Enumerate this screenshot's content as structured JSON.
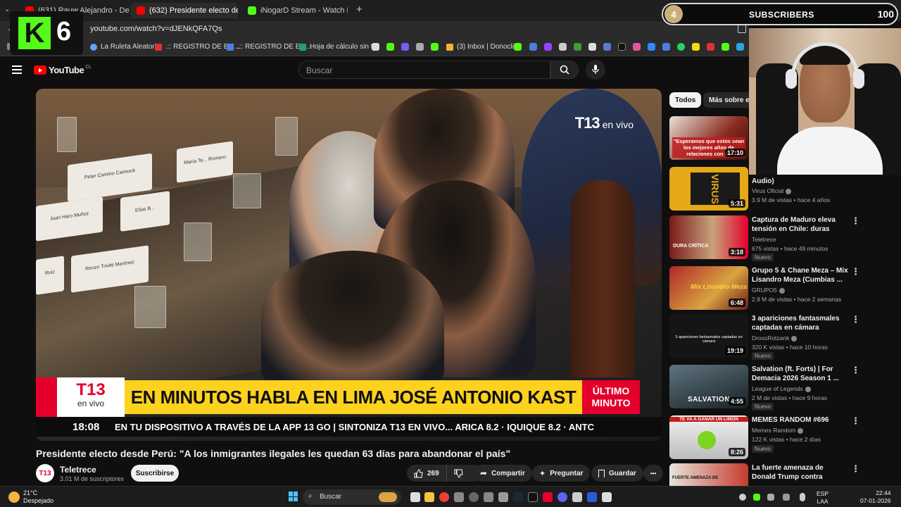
{
  "browser": {
    "tabs": [
      {
        "label": "(631) Rauw Alejandro - Detectiv",
        "active": false,
        "color": "#ff0000"
      },
      {
        "label": "(632) Presidente electo des",
        "active": true,
        "color": "#ff0000"
      },
      {
        "label": "iNogarD Stream - Watch Live o",
        "active": false,
        "color": "#53fc18"
      }
    ],
    "new_tab": "+",
    "url": "youtube.com/watch?v=dJENkQFA7Qs",
    "bookmarks": [
      {
        "label": "La Ruleta Aleatoria"
      },
      {
        "label": ".:: REGISTRO DE EM..."
      },
      {
        "label": ".:: REGISTRO DE EM..."
      },
      {
        "label": "Hoja de cálculo sin t..."
      },
      {
        "label": "(3) Inbox | Donoclip"
      }
    ]
  },
  "youtube": {
    "logo": "YouTube",
    "country": "CL",
    "search_placeholder": "Buscar",
    "video": {
      "overlay_brand": "T13",
      "overlay_live": "en vivo",
      "nameplates": [
        "Peter Camino Cannock",
        "Juan Haro Muñoz",
        "Ruiz",
        "Renzo Trivitti Martínez",
        "Elías B...",
        "María Te... Romero"
      ],
      "lower_third_brand": "T13",
      "lower_third_live": "en vivo",
      "headline": "EN MINUTOS HABLA EN LIMA JOSÉ ANTONIO KAST",
      "breaking_line1": "ÚLTIMO",
      "breaking_line2": "MINUTO",
      "ticker_time": "18:08",
      "ticker_text": "EN TU DISPOSITIVO A TRAVÉS DE LA APP 13 GO   |   SINTONIZA T13 EN VIVO... ARICA 8.2  ·  IQUIQUE 8.2  ·  ANTC"
    },
    "title": "Presidente electo desde Perú: \"A los inmigrantes ilegales les quedan 63 días para abandonar el país\"",
    "channel": {
      "avatar": "T13",
      "name": "Teletrece",
      "subscribers": "3.01 M de suscriptores",
      "subscribe_label": "Suscribirse"
    },
    "actions": {
      "likes": "269",
      "share": "Compartir",
      "ask": "Preguntar",
      "save": "Guardar",
      "more": "•••"
    },
    "chips": [
      "Todos",
      "Más sobre es"
    ],
    "recommendations": [
      {
        "title": "\"Esperamos que estos sean los mejores años de relaciones con Pe...",
        "thumb_text": "\"Esperamos que estos sean los mejores años de relaciones con Pe",
        "channel": "",
        "meta": "",
        "duration": "17:10",
        "badge": "",
        "thumb_color": "#8a2b1f"
      },
      {
        "title": "Audio)",
        "thumb_text": "VIRUS",
        "channel": "Virus Oficial",
        "meta": "3.9 M de vistas • hace 4 años",
        "duration": "5:31",
        "badge": "",
        "thumb_color": "#e6a817"
      },
      {
        "title": "Captura de Maduro eleva tensión en Chile: duras crítica...",
        "thumb_text": "DURA CRÍTICA",
        "channel": "Teletrece",
        "meta": "675 vistas • hace 49 minutos",
        "duration": "3:18",
        "badge": "Nuevo",
        "thumb_color": "#7a1a1a"
      },
      {
        "title": "Grupo 5 & Chane Meza – Mix Lisandro Meza (Cumbias ...",
        "thumb_text": "Mix Lisandro Meza",
        "channel": "GRUPO5",
        "meta": "2.9 M de vistas • hace 2 semanas",
        "duration": "6:48",
        "badge": "",
        "thumb_color": "#b0262a"
      },
      {
        "title": "3 apariciones fantasmales captadas en cámara",
        "thumb_text": "3 apariciones fantasmales captadas en cámara",
        "channel": "DrossRotzank",
        "meta": "320 K vistas • hace 10 horas",
        "duration": "19:19",
        "badge": "Nuevo",
        "thumb_color": "#1a1a1a"
      },
      {
        "title": "Salvation (ft. Forts) | For Demacia 2026 Season 1 ...",
        "thumb_text": "SALVATION",
        "channel": "League of Legends",
        "meta": "2 M de vistas • hace 9 horas",
        "duration": "4:55",
        "badge": "Nuevo",
        "thumb_color": "#3b4a52"
      },
      {
        "title": "MEMES RANDOM #696",
        "thumb_text": "TE VA A GANAR UN LIMÓN",
        "channel": "Memes Random",
        "meta": "122 K vistas • hace 2 días",
        "duration": "8:26",
        "badge": "Nuevo",
        "thumb_color": "#d8d8d8"
      },
      {
        "title": "La fuerte amenaza de Donald Trump contra Diosdado Cabell...",
        "thumb_text": "FUERTE AMENAZA DE",
        "channel": "",
        "meta": "",
        "duration": "",
        "badge": "",
        "thumb_color": "#c43b2f"
      }
    ]
  },
  "stream_overlay": {
    "kick_letter": "K",
    "kick_number": "6",
    "sub_count": "4",
    "sub_label": "SUBSCRIBERS",
    "sub_goal": "100"
  },
  "taskbar": {
    "temp": "21°C",
    "weather": "Despejado",
    "search": "Buscar",
    "lang1": "ESP",
    "lang2": "LAA",
    "time": "22:44",
    "date": "07-01-2026"
  }
}
